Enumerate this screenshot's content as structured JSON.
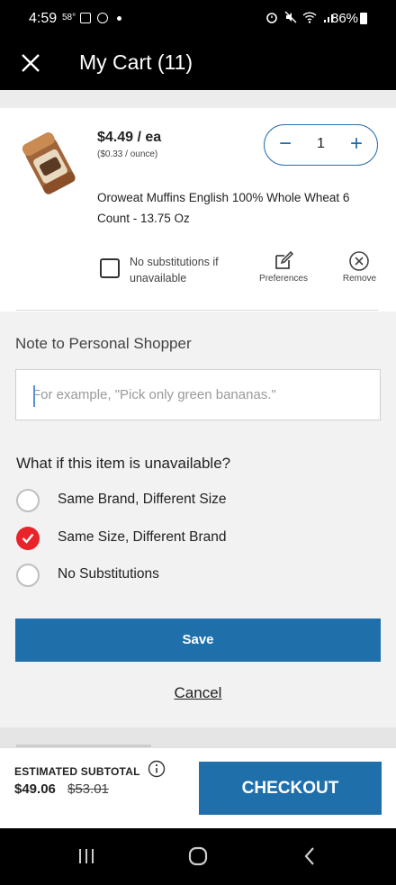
{
  "status_bar": {
    "time": "4:59",
    "temperature": "58°",
    "battery": "86%"
  },
  "header": {
    "title": "My Cart (11)",
    "close_icon": "close-icon"
  },
  "cart_item": {
    "price": "$4.49 / ea",
    "unit_price": "($0.33 / ounce)",
    "quantity": "1",
    "name": "Oroweat Muffins English 100% Whole Wheat 6 Count - 13.75 Oz",
    "no_substitutions_label": "No substitutions if unavailable",
    "preferences_label": "Preferences",
    "remove_label": "Remove"
  },
  "shopper_note": {
    "title": "Note to Personal Shopper",
    "placeholder": "For example, \"Pick only green bananas.\"",
    "value": ""
  },
  "unavailable": {
    "question": "What if this item is unavailable?",
    "options": [
      {
        "label": "Same Brand, Different Size",
        "selected": false
      },
      {
        "label": "Same Size, Different Brand",
        "selected": true
      },
      {
        "label": "No Substitutions",
        "selected": false
      }
    ]
  },
  "actions": {
    "save_label": "Save",
    "cancel_label": "Cancel"
  },
  "footer": {
    "subtotal_label": "ESTIMATED SUBTOTAL",
    "subtotal_value": "$49.06",
    "subtotal_original": "$53.01",
    "checkout_label": "CHECKOUT"
  },
  "colors": {
    "primary_blue": "#1f6fab",
    "selected_red": "#e8232a"
  }
}
